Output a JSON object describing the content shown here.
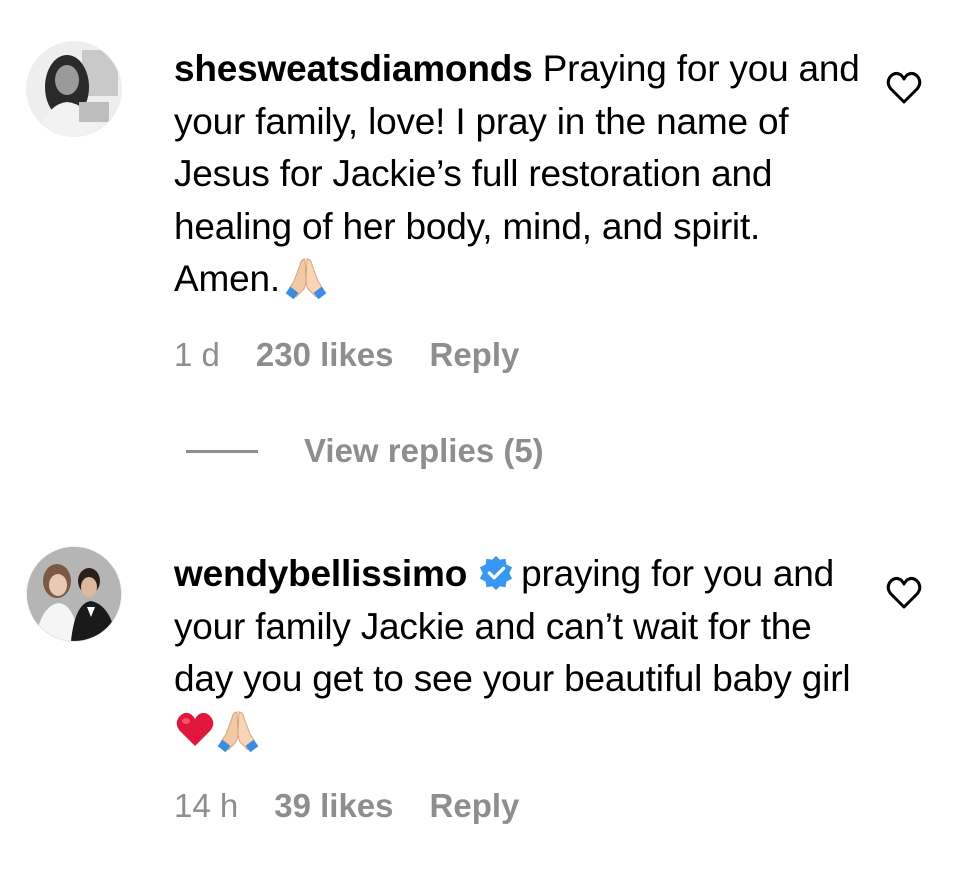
{
  "comments": [
    {
      "username": "shesweatsdiamonds",
      "verified": false,
      "text": "Praying for you and your family, love! I pray in the name of Jesus for Jackie’s full restoration and healing of her body, mind, and spirit. Amen.",
      "emoji": [
        "folded-hands"
      ],
      "time": "1 d",
      "likes": "230 likes",
      "reply_label": "Reply"
    },
    {
      "username": "wendybellissimo",
      "verified": true,
      "text": "praying for you and your family Jackie and can’t wait for the day you get to see your beautiful baby girl",
      "emoji": [
        "red-heart",
        "folded-hands"
      ],
      "time": "14 h",
      "likes": "39 likes",
      "reply_label": "Reply"
    }
  ],
  "view_replies": "View replies (5)",
  "icons": {
    "like": "heart-outline-icon",
    "verified": "verified-badge-icon"
  },
  "colors": {
    "secondary_text": "#8e8e8e",
    "verified_blue": "#3897f0",
    "heart_red": "#e0163c"
  }
}
